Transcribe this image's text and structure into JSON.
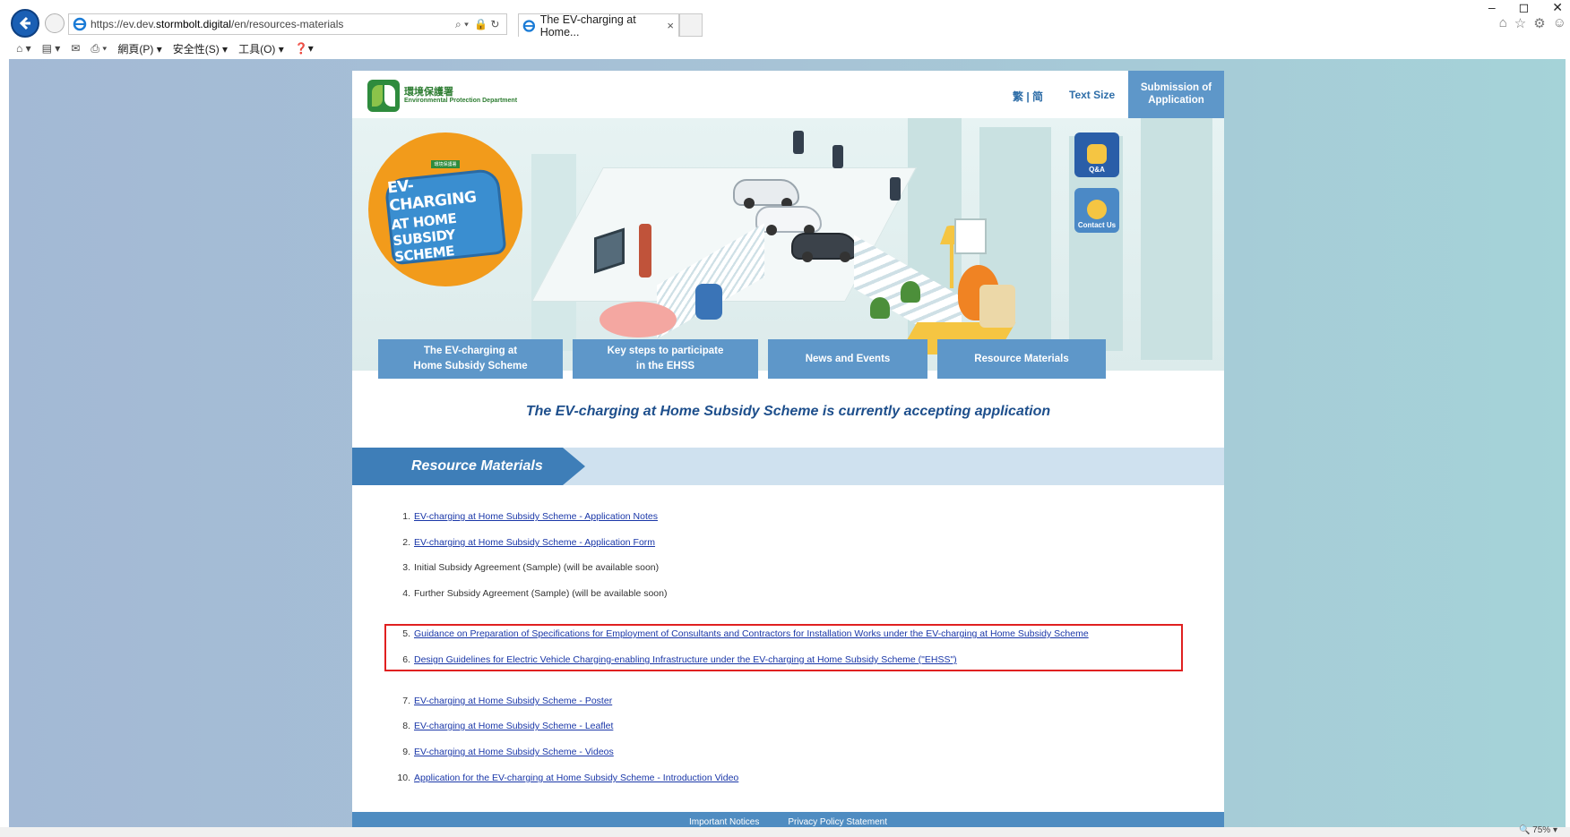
{
  "browser": {
    "url_prefix": "https://ev.dev.",
    "url_host": "stormbolt.digital",
    "url_path": "/en/resources-materials",
    "tab_title": "The EV-charging at Home...",
    "tab_close": "×",
    "window_controls": [
      "–",
      "◻",
      "✕"
    ],
    "right_icons": [
      "⌂",
      "☆",
      "⚙",
      "☺"
    ],
    "address_tools": [
      "⌕ ▾",
      "🔒 ↻"
    ],
    "command_bar": {
      "page": "網頁(P) ▾",
      "safety": "安全性(S) ▾",
      "tools": "工具(O) ▾",
      "help": "❓▾"
    },
    "zoom": "🔍 75%  ▾"
  },
  "site": {
    "logo_zh": "環境保護署",
    "logo_en": "Environmental Protection Department",
    "lang_toggle": "繁 | 简",
    "text_size": "Text Size",
    "submit_button": "Submission of Application",
    "banner": {
      "badge_mini": "環境保護署",
      "badge_line1": "EV-CHARGING",
      "badge_line2": "AT HOME SUBSIDY SCHEME"
    },
    "side_buttons": {
      "qa": "Q&A",
      "contact": "Contact Us"
    },
    "nav": [
      {
        "line1": "The EV-charging at",
        "line2": "Home Subsidy Scheme"
      },
      {
        "line1": "Key steps to participate",
        "line2": "in the EHSS"
      },
      {
        "line1": "News and Events",
        "line2": ""
      },
      {
        "line1": "Resource Materials",
        "line2": ""
      }
    ],
    "announcement": "The EV-charging at Home Subsidy Scheme is currently accepting application",
    "section_title": "Resource Materials",
    "resources": [
      {
        "num": "1.",
        "text": "EV-charging at Home Subsidy Scheme - Application Notes",
        "link": true
      },
      {
        "num": "2.",
        "text": "EV-charging at Home Subsidy Scheme - Application Form",
        "link": true
      },
      {
        "num": "3.",
        "text": "Initial Subsidy Agreement (Sample) (will be available soon)",
        "link": false
      },
      {
        "num": "4.",
        "text": "Further Subsidy Agreement (Sample) (will be available soon)",
        "link": false
      },
      {
        "num": "5.",
        "text": "Guidance on Preparation of Specifications for Employment of Consultants and Contractors for Installation Works under the EV-charging at Home Subsidy Scheme",
        "link": true
      },
      {
        "num": "6.",
        "text": "Design Guidelines for Electric Vehicle Charging-enabling Infrastructure under the EV-charging at Home Subsidy Scheme (\"EHSS\")",
        "link": true
      },
      {
        "num": "7.",
        "text": "EV-charging at Home Subsidy Scheme - Poster",
        "link": true
      },
      {
        "num": "8.",
        "text": "EV-charging at Home Subsidy Scheme - Leaflet",
        "link": true
      },
      {
        "num": "9.",
        "text": "EV-charging at Home Subsidy Scheme - Videos",
        "link": true
      },
      {
        "num": "10.",
        "text": "Application for the EV-charging at Home Subsidy Scheme - Introduction Video",
        "link": true
      }
    ],
    "footer_links": [
      "Important Notices",
      "Privacy Policy Statement"
    ]
  },
  "colors": {
    "accent_blue": "#5e97c9",
    "section_blue": "#3e7eb8",
    "link": "#1a37a8",
    "highlight": "#e02020"
  }
}
